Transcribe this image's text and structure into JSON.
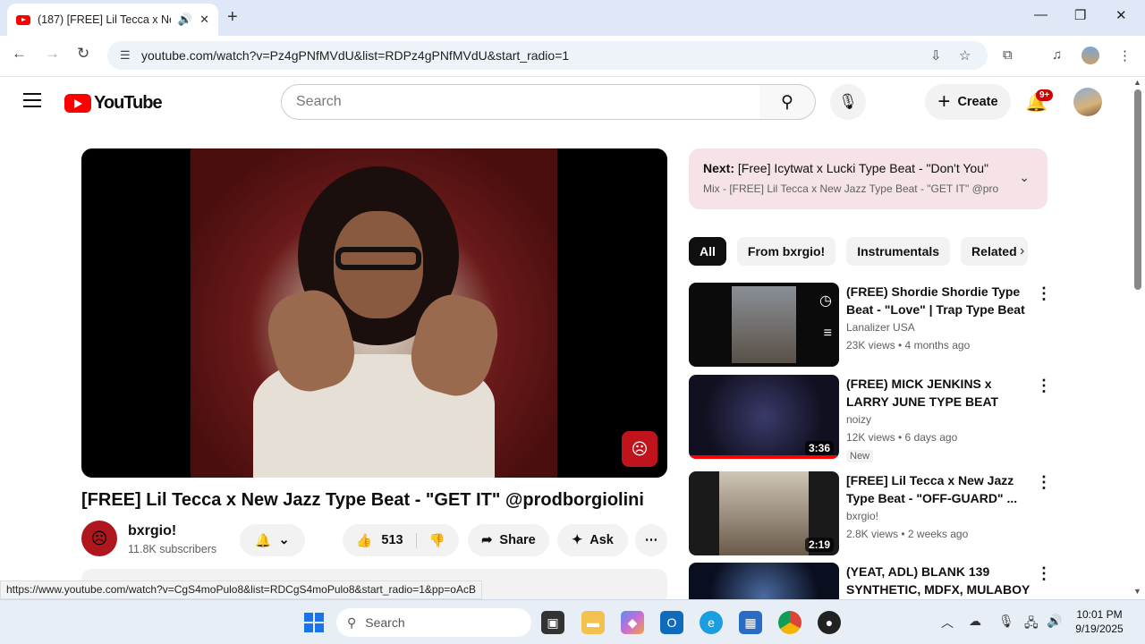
{
  "browser": {
    "tab_title": "(187) [FREE] Lil Tecca x New",
    "new_tab": "+",
    "url": "youtube.com/watch?v=Pz4gPNfMVdU&list=RDPz4gPNfMVdU&start_radio=1",
    "status_url": "https://www.youtube.com/watch?v=CgS4moPulo8&list=RDCgS4moPulo8&start_radio=1&pp=oAcB"
  },
  "header": {
    "logo_text": "YouTube",
    "search_placeholder": "Search",
    "create_label": "Create",
    "notif_badge": "9+"
  },
  "video": {
    "title": "[FREE] Lil Tecca x New Jazz Type Beat - \"GET IT\" @prodborgiolini",
    "channel": "bxrgio!",
    "subscribers": "11.8K subscribers",
    "likes": "513",
    "share_label": "Share",
    "ask_label": "Ask"
  },
  "up_next": {
    "prefix": "Next:",
    "title": "[Free] Icytwat x Lucki Type Beat - \"Don't You\"",
    "subtitle": "Mix - [FREE] Lil Tecca x New Jazz Type Beat - \"GET IT\" @pro..."
  },
  "chips": [
    "All",
    "From bxrgio!",
    "Instrumentals",
    "Related"
  ],
  "recommendations": [
    {
      "title": "(FREE) Shordie Shordie Type Beat - \"Love\" | Trap Type Beat ...",
      "channel": "Lanalizer USA",
      "meta": "23K views • 4 months ago",
      "duration": "",
      "badge": ""
    },
    {
      "title": "(FREE) MICK JENKINS x LARRY JUNE TYPE BEAT \"MILE HIGH\"...",
      "channel": "noizy",
      "meta": "12K views • 6 days ago",
      "duration": "3:36",
      "badge": "New"
    },
    {
      "title": "[FREE] Lil Tecca x New Jazz Type Beat - \"OFF-GUARD\" ...",
      "channel": "bxrgio!",
      "meta": "2.8K views • 2 weeks ago",
      "duration": "2:19",
      "badge": ""
    },
    {
      "title": "(YEAT, ADL) BLANK 139 SYNTHETIC, MDFX, MULABOY",
      "channel": "",
      "meta": "",
      "duration": "",
      "badge": ""
    }
  ],
  "taskbar": {
    "search_label": "Search",
    "time": "10:01 PM",
    "date": "9/19/2025"
  },
  "colors": {
    "youtube_red": "#ff0000",
    "upnext_bg": "#f6e3e7",
    "chip_active": "#0f0f0f"
  }
}
